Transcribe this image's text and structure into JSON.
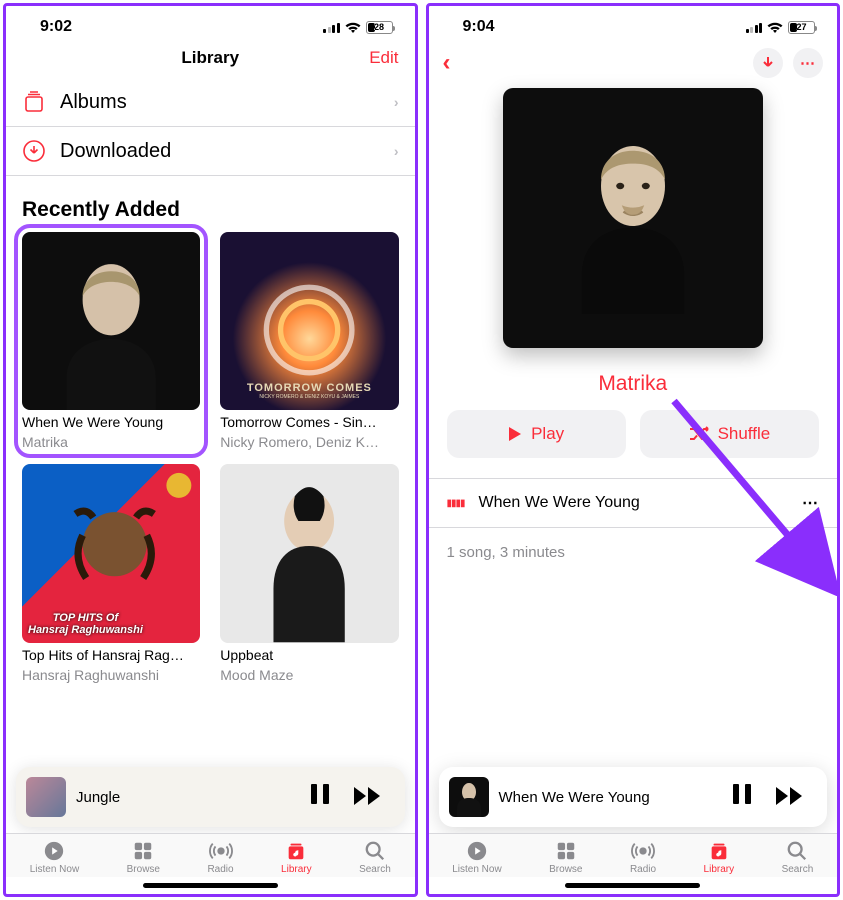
{
  "p1": {
    "status": {
      "time": "9:02",
      "battery": "28"
    },
    "nav": {
      "title": "Library",
      "edit": "Edit"
    },
    "rows": {
      "albums": "Albums",
      "downloaded": "Downloaded"
    },
    "section": "Recently Added",
    "albums": [
      {
        "title": "When We Were Young",
        "artist": "Matrika"
      },
      {
        "title": "Tomorrow Comes - Sin…",
        "artist": "Nicky Romero, Deniz K…",
        "art_label": "TOMORROW COMES",
        "art_sub": "NICKY ROMERO & DENIZ KOYU & JAIMES"
      },
      {
        "title": "Top Hits of Hansraj Rag…",
        "artist": "Hansraj Raghuwanshi",
        "art_top": "TOP HITS Of",
        "art_bottom": "Hansraj Raghuwanshi"
      },
      {
        "title": "Uppbeat",
        "artist": "Mood Maze"
      }
    ],
    "nowplaying": {
      "title": "Jungle"
    },
    "tabs": [
      "Listen Now",
      "Browse",
      "Radio",
      "Library",
      "Search"
    ]
  },
  "p2": {
    "status": {
      "time": "9:04",
      "battery": "27"
    },
    "artist": "Matrika",
    "buttons": {
      "play": "Play",
      "shuffle": "Shuffle"
    },
    "track": "When We Were Young",
    "summary": "1 song, 3 minutes",
    "nowplaying": {
      "title": "When We Were Young"
    },
    "tabs": [
      "Listen Now",
      "Browse",
      "Radio",
      "Library",
      "Search"
    ]
  }
}
